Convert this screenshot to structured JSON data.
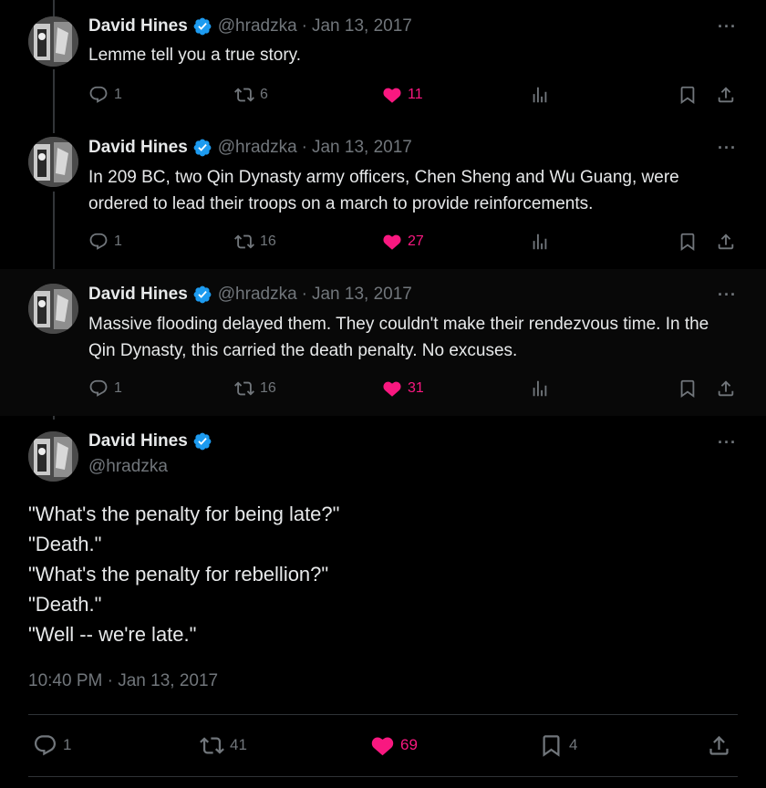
{
  "colors": {
    "like": "#f91880",
    "verified": "#1d9bf0",
    "muted": "#71767b"
  },
  "tweets": [
    {
      "name": "David Hines",
      "handle": "@hradzka",
      "date": "Jan 13, 2017",
      "sep": "·",
      "more": "···",
      "text": "Lemme tell you a true story.",
      "replies": "1",
      "reposts": "6",
      "likes": "11"
    },
    {
      "name": "David Hines",
      "handle": "@hradzka",
      "date": "Jan 13, 2017",
      "sep": "·",
      "more": "···",
      "text": "In 209 BC, two Qin Dynasty army officers, Chen Sheng and Wu Guang, were ordered to lead their troops on a march to provide reinforcements.",
      "replies": "1",
      "reposts": "16",
      "likes": "27"
    },
    {
      "name": "David Hines",
      "handle": "@hradzka",
      "date": "Jan 13, 2017",
      "sep": "·",
      "more": "···",
      "text": "Massive flooding delayed them. They couldn't make their rendezvous time. In the Qin Dynasty, this carried the death penalty. No excuses.",
      "replies": "1",
      "reposts": "16",
      "likes": "31"
    }
  ],
  "main_tweet": {
    "name": "David Hines",
    "handle": "@hradzka",
    "more": "···",
    "lines": [
      "\"What's the penalty for being late?\"",
      "\"Death.\"",
      "\"What's the penalty for rebellion?\"",
      "\"Death.\"",
      "\"Well -- we're late.\""
    ],
    "timestamp": "10:40 PM · Jan 13, 2017",
    "replies": "1",
    "reposts": "41",
    "likes": "69",
    "bookmarks": "4"
  },
  "icons": [
    "reply-icon",
    "repost-icon",
    "like-icon",
    "views-icon",
    "bookmark-icon",
    "share-icon",
    "verified-badge-icon",
    "more-icon"
  ]
}
